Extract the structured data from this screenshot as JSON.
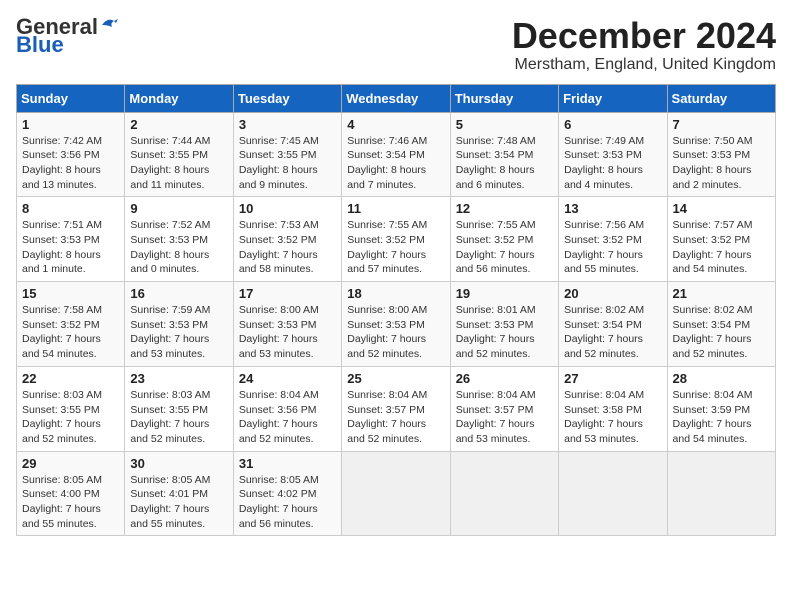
{
  "header": {
    "logo_general": "General",
    "logo_blue": "Blue",
    "month_title": "December 2024",
    "subtitle": "Merstham, England, United Kingdom"
  },
  "days_of_week": [
    "Sunday",
    "Monday",
    "Tuesday",
    "Wednesday",
    "Thursday",
    "Friday",
    "Saturday"
  ],
  "weeks": [
    [
      {
        "day": "1",
        "data": "Sunrise: 7:42 AM\nSunset: 3:56 PM\nDaylight: 8 hours and 13 minutes."
      },
      {
        "day": "2",
        "data": "Sunrise: 7:44 AM\nSunset: 3:55 PM\nDaylight: 8 hours and 11 minutes."
      },
      {
        "day": "3",
        "data": "Sunrise: 7:45 AM\nSunset: 3:55 PM\nDaylight: 8 hours and 9 minutes."
      },
      {
        "day": "4",
        "data": "Sunrise: 7:46 AM\nSunset: 3:54 PM\nDaylight: 8 hours and 7 minutes."
      },
      {
        "day": "5",
        "data": "Sunrise: 7:48 AM\nSunset: 3:54 PM\nDaylight: 8 hours and 6 minutes."
      },
      {
        "day": "6",
        "data": "Sunrise: 7:49 AM\nSunset: 3:53 PM\nDaylight: 8 hours and 4 minutes."
      },
      {
        "day": "7",
        "data": "Sunrise: 7:50 AM\nSunset: 3:53 PM\nDaylight: 8 hours and 2 minutes."
      }
    ],
    [
      {
        "day": "8",
        "data": "Sunrise: 7:51 AM\nSunset: 3:53 PM\nDaylight: 8 hours and 1 minute."
      },
      {
        "day": "9",
        "data": "Sunrise: 7:52 AM\nSunset: 3:53 PM\nDaylight: 8 hours and 0 minutes."
      },
      {
        "day": "10",
        "data": "Sunrise: 7:53 AM\nSunset: 3:52 PM\nDaylight: 7 hours and 58 minutes."
      },
      {
        "day": "11",
        "data": "Sunrise: 7:55 AM\nSunset: 3:52 PM\nDaylight: 7 hours and 57 minutes."
      },
      {
        "day": "12",
        "data": "Sunrise: 7:55 AM\nSunset: 3:52 PM\nDaylight: 7 hours and 56 minutes."
      },
      {
        "day": "13",
        "data": "Sunrise: 7:56 AM\nSunset: 3:52 PM\nDaylight: 7 hours and 55 minutes."
      },
      {
        "day": "14",
        "data": "Sunrise: 7:57 AM\nSunset: 3:52 PM\nDaylight: 7 hours and 54 minutes."
      }
    ],
    [
      {
        "day": "15",
        "data": "Sunrise: 7:58 AM\nSunset: 3:52 PM\nDaylight: 7 hours and 54 minutes."
      },
      {
        "day": "16",
        "data": "Sunrise: 7:59 AM\nSunset: 3:53 PM\nDaylight: 7 hours and 53 minutes."
      },
      {
        "day": "17",
        "data": "Sunrise: 8:00 AM\nSunset: 3:53 PM\nDaylight: 7 hours and 53 minutes."
      },
      {
        "day": "18",
        "data": "Sunrise: 8:00 AM\nSunset: 3:53 PM\nDaylight: 7 hours and 52 minutes."
      },
      {
        "day": "19",
        "data": "Sunrise: 8:01 AM\nSunset: 3:53 PM\nDaylight: 7 hours and 52 minutes."
      },
      {
        "day": "20",
        "data": "Sunrise: 8:02 AM\nSunset: 3:54 PM\nDaylight: 7 hours and 52 minutes."
      },
      {
        "day": "21",
        "data": "Sunrise: 8:02 AM\nSunset: 3:54 PM\nDaylight: 7 hours and 52 minutes."
      }
    ],
    [
      {
        "day": "22",
        "data": "Sunrise: 8:03 AM\nSunset: 3:55 PM\nDaylight: 7 hours and 52 minutes."
      },
      {
        "day": "23",
        "data": "Sunrise: 8:03 AM\nSunset: 3:55 PM\nDaylight: 7 hours and 52 minutes."
      },
      {
        "day": "24",
        "data": "Sunrise: 8:04 AM\nSunset: 3:56 PM\nDaylight: 7 hours and 52 minutes."
      },
      {
        "day": "25",
        "data": "Sunrise: 8:04 AM\nSunset: 3:57 PM\nDaylight: 7 hours and 52 minutes."
      },
      {
        "day": "26",
        "data": "Sunrise: 8:04 AM\nSunset: 3:57 PM\nDaylight: 7 hours and 53 minutes."
      },
      {
        "day": "27",
        "data": "Sunrise: 8:04 AM\nSunset: 3:58 PM\nDaylight: 7 hours and 53 minutes."
      },
      {
        "day": "28",
        "data": "Sunrise: 8:04 AM\nSunset: 3:59 PM\nDaylight: 7 hours and 54 minutes."
      }
    ],
    [
      {
        "day": "29",
        "data": "Sunrise: 8:05 AM\nSunset: 4:00 PM\nDaylight: 7 hours and 55 minutes."
      },
      {
        "day": "30",
        "data": "Sunrise: 8:05 AM\nSunset: 4:01 PM\nDaylight: 7 hours and 55 minutes."
      },
      {
        "day": "31",
        "data": "Sunrise: 8:05 AM\nSunset: 4:02 PM\nDaylight: 7 hours and 56 minutes."
      },
      {
        "day": "",
        "data": ""
      },
      {
        "day": "",
        "data": ""
      },
      {
        "day": "",
        "data": ""
      },
      {
        "day": "",
        "data": ""
      }
    ]
  ]
}
